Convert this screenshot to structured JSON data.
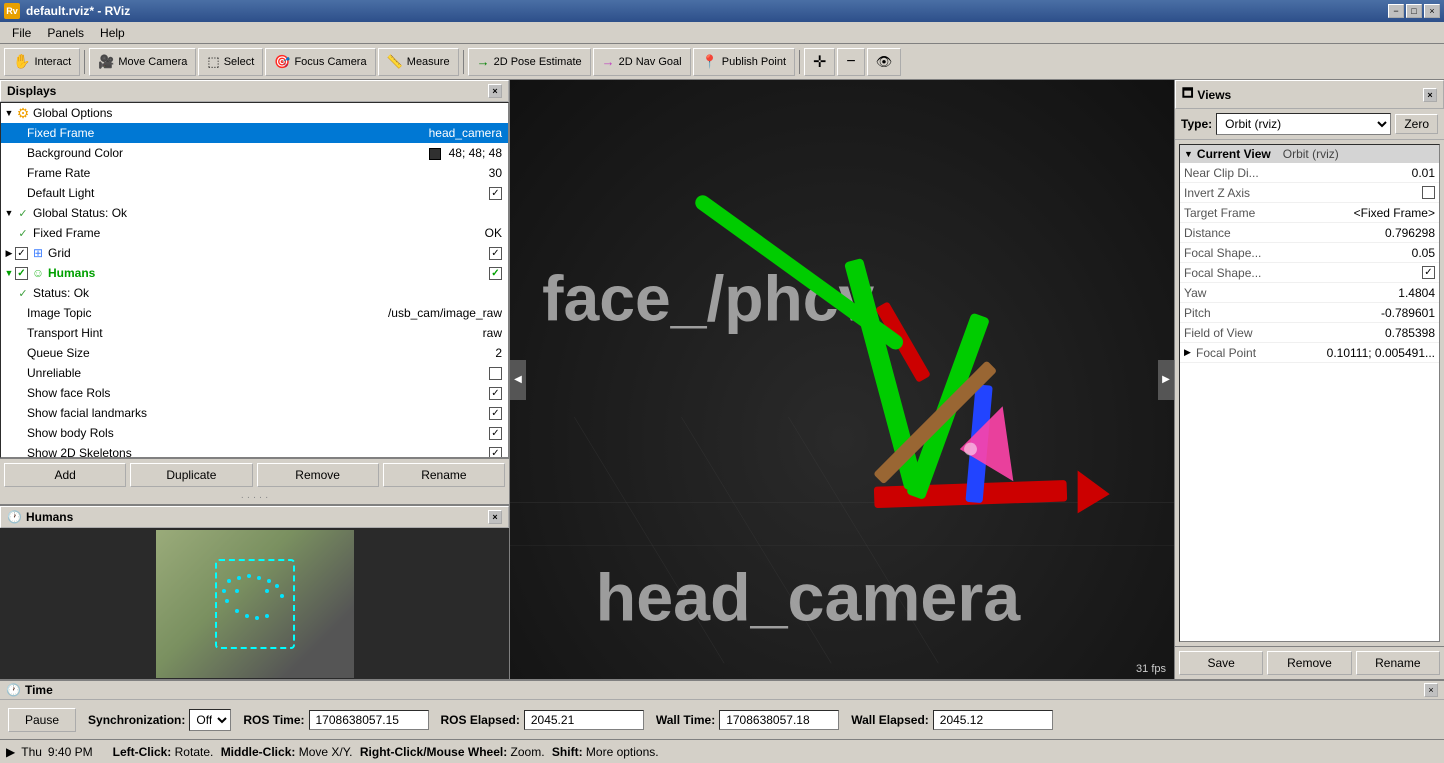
{
  "titlebar": {
    "title": "default.rviz* - RViz",
    "icon": "Rv",
    "min": "−",
    "max": "□",
    "close": "×"
  },
  "menubar": {
    "items": [
      "File",
      "Panels",
      "Help"
    ]
  },
  "toolbar": {
    "interact_label": "Interact",
    "move_camera_label": "Move Camera",
    "select_label": "Select",
    "focus_camera_label": "Focus Camera",
    "measure_label": "Measure",
    "pose_estimate_label": "2D Pose Estimate",
    "nav_goal_label": "2D Nav Goal",
    "publish_point_label": "Publish Point"
  },
  "displays_panel": {
    "title": "Displays",
    "global_options": {
      "label": "Global Options",
      "icon": "gear",
      "expanded": true,
      "fixed_frame_label": "Fixed Frame",
      "fixed_frame_value": "head_camera",
      "bg_color_label": "Background Color",
      "bg_color_value": "48; 48; 48",
      "frame_rate_label": "Frame Rate",
      "frame_rate_value": "30",
      "default_light_label": "Default Light",
      "default_light_checked": true
    },
    "global_status": {
      "label": "Global Status: Ok",
      "icon": "check",
      "expanded": true,
      "fixed_frame_label": "Fixed Frame",
      "fixed_frame_value": "OK"
    },
    "grid": {
      "label": "Grid",
      "icon": "grid",
      "checked": true
    },
    "humans": {
      "label": "Humans",
      "icon": "face",
      "checked": true,
      "expanded": true,
      "status_label": "Status: Ok",
      "image_topic_label": "Image Topic",
      "image_topic_value": "/usb_cam/image_raw",
      "transport_hint_label": "Transport Hint",
      "transport_hint_value": "raw",
      "queue_size_label": "Queue Size",
      "queue_size_value": "2",
      "unreliable_label": "Unreliable",
      "unreliable_checked": false,
      "show_face_rols_label": "Show face Rols",
      "show_face_rols_checked": true,
      "show_facial_landmarks_label": "Show facial landmarks",
      "show_facial_landmarks_checked": true,
      "show_body_rols_label": "Show body Rols",
      "show_body_rols_checked": true,
      "show_2d_skeletons_label": "Show 2D Skeletons",
      "show_2d_skeletons_checked": true
    },
    "buttons": {
      "add": "Add",
      "duplicate": "Duplicate",
      "remove": "Remove",
      "rename": "Rename"
    }
  },
  "humans_camera_panel": {
    "title": "Humans"
  },
  "viewport": {
    "face_text": "face_/phcv",
    "camera_text": "head_camera",
    "fps": "31 fps"
  },
  "views_panel": {
    "title": "Views",
    "type_label": "Type:",
    "type_value": "Orbit (rviz)",
    "zero_btn": "Zero",
    "current_view": {
      "header": "Current View",
      "type": "Orbit (rviz)",
      "near_clip_label": "Near Clip Di...",
      "near_clip_value": "0.01",
      "invert_z_label": "Invert Z Axis",
      "invert_z_checked": false,
      "target_frame_label": "Target Frame",
      "target_frame_value": "<Fixed Frame>",
      "distance_label": "Distance",
      "distance_value": "0.796298",
      "focal_shape1_label": "Focal Shape...",
      "focal_shape1_value": "0.05",
      "focal_shape2_label": "Focal Shape...",
      "focal_shape2_checked": true,
      "yaw_label": "Yaw",
      "yaw_value": "1.4804",
      "pitch_label": "Pitch",
      "pitch_value": "-0.789601",
      "fov_label": "Field of View",
      "fov_value": "0.785398",
      "focal_point_label": "Focal Point",
      "focal_point_value": "0.10111; 0.005491..."
    },
    "buttons": {
      "save": "Save",
      "remove": "Remove",
      "rename": "Rename"
    }
  },
  "time_panel": {
    "title": "Time",
    "pause_btn": "Pause",
    "sync_label": "Synchronization:",
    "sync_value": "Off",
    "ros_time_label": "ROS Time:",
    "ros_time_value": "1708638057.15",
    "ros_elapsed_label": "ROS Elapsed:",
    "ros_elapsed_value": "2045.21",
    "wall_time_label": "Wall Time:",
    "wall_time_value": "1708638057.18",
    "wall_elapsed_label": "Wall Elapsed:",
    "wall_elapsed_value": "2045.12"
  },
  "statusbar": {
    "day": "Thu",
    "time": "9:40 PM",
    "hint_leftclick": "Left-Click:",
    "hint_leftclick_val": "Rotate.",
    "hint_middleclick": "Middle-Click:",
    "hint_middleclick_val": "Move X/Y.",
    "hint_rightclick": "Right-Click/Mouse Wheel:",
    "hint_rightclick_val": "Zoom.",
    "hint_shift": "Shift:",
    "hint_shift_val": "More options."
  }
}
